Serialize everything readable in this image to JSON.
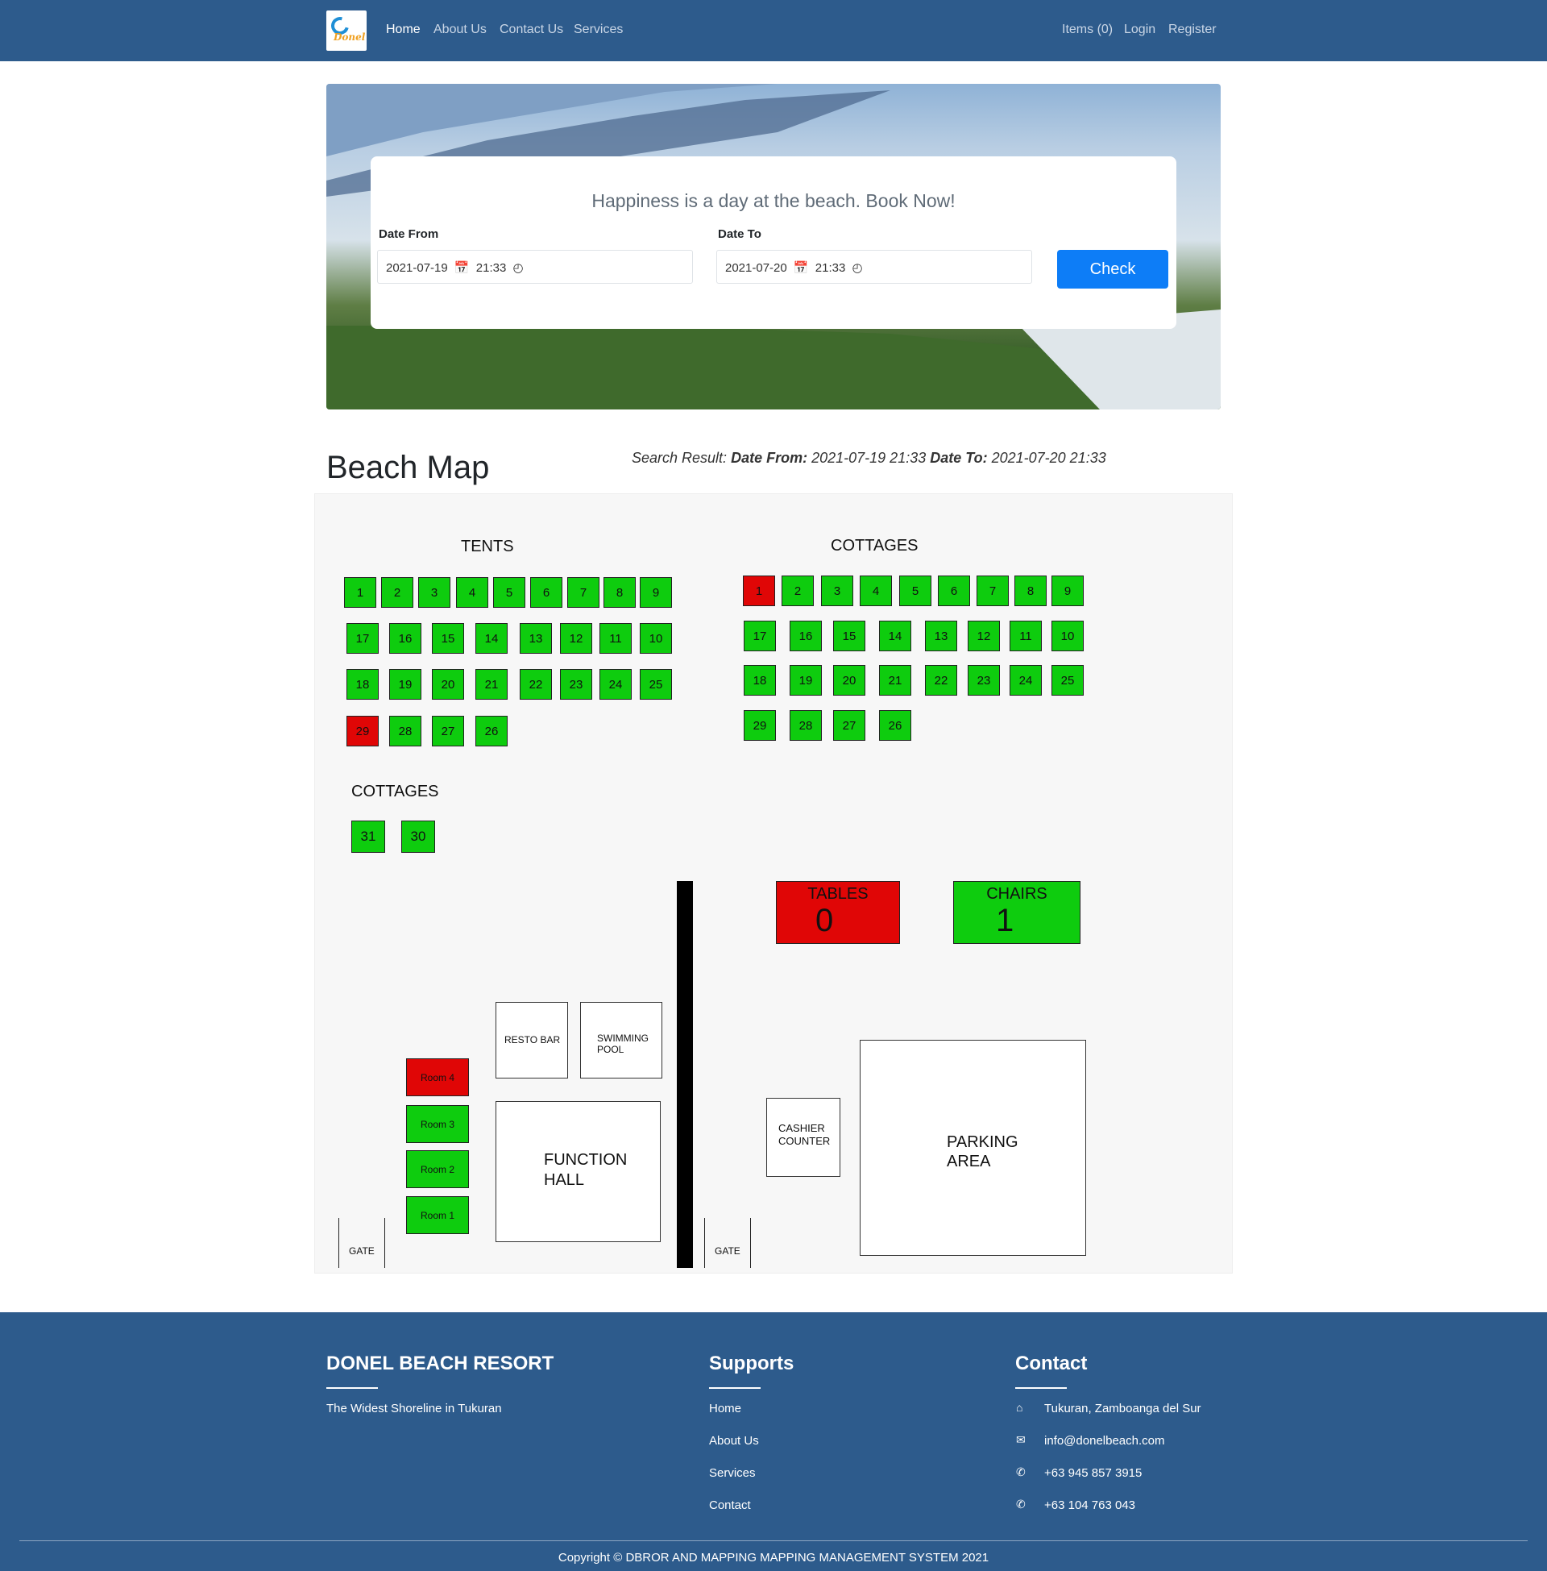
{
  "nav": {
    "logo_text": "Donel",
    "links": [
      "Home",
      "About Us",
      "Contact Us",
      "Services"
    ],
    "items": "Items (0)",
    "login": "Login",
    "register": "Register"
  },
  "booking": {
    "title": "Happiness is a day at the beach. Book Now!",
    "date_from_label": "Date From",
    "date_to_label": "Date To",
    "date_from_date": "2021-07-19",
    "date_from_time": "21:33",
    "date_to_date": "2021-07-20",
    "date_to_time": "21:33",
    "check_label": "Check"
  },
  "map": {
    "title": "Beach Map",
    "search_prefix": "Search Result:",
    "search_from_label": "Date From:",
    "search_from_value": "2021-07-19 21:33",
    "search_to_label": "Date To:",
    "search_to_value": "2021-07-20 21:33",
    "tents_label": "TENTS",
    "cottages_label": "COTTAGES",
    "cottages2_label": "COTTAGES",
    "tents_rows": [
      [
        "1",
        "2",
        "3",
        "4",
        "5",
        "6",
        "7",
        "8",
        "9"
      ],
      [
        "17",
        "16",
        "15",
        "14",
        "13",
        "12",
        "11",
        "10"
      ],
      [
        "18",
        "19",
        "20",
        "21",
        "22",
        "23",
        "24",
        "25"
      ],
      [
        "29",
        "28",
        "27",
        "26"
      ]
    ],
    "cottage_rows": [
      [
        "1",
        "2",
        "3",
        "4",
        "5",
        "6",
        "7",
        "8",
        "9"
      ],
      [
        "17",
        "16",
        "15",
        "14",
        "13",
        "12",
        "11",
        "10"
      ],
      [
        "18",
        "19",
        "20",
        "21",
        "22",
        "23",
        "24",
        "25"
      ],
      [
        "29",
        "28",
        "27",
        "26"
      ]
    ],
    "cottages2": [
      "31",
      "30"
    ],
    "reserved_color": "#e00606",
    "available_color": "#0ecc0e",
    "reserved_tents": [
      "29"
    ],
    "reserved_cottages": [
      "1"
    ],
    "tables_label": "TABLES",
    "tables_value": "0",
    "chairs_label": "CHAIRS",
    "chairs_value": "1",
    "resto_bar": "RESTO BAR",
    "pool_line1": "SWIMMING",
    "pool_line2": "POOL",
    "function_line1": "FUNCTION",
    "function_line2": "HALL",
    "cashier_line1": "CASHIER",
    "cashier_line2": "COUNTER",
    "parking_line1": "PARKING",
    "parking_line2": "AREA",
    "rooms": [
      "Room 4",
      "Room 3",
      "Room 2",
      "Room 1"
    ],
    "reserved_rooms": [
      "Room 4"
    ],
    "gate_label": "GATE"
  },
  "footer": {
    "brand": "DONEL BEACH RESORT",
    "tagline": "The Widest Shoreline in Tukuran",
    "supports_title": "Supports",
    "supports_links": [
      "Home",
      "About Us",
      "Services",
      "Contact"
    ],
    "contact_title": "Contact",
    "address": "Tukuran, Zamboanga del Sur",
    "email": "info@donelbeach.com",
    "phone1": "+63 945 857 3915",
    "phone2": "+63 104 763 043",
    "copyright": "Copyright © DBROR AND MAPPING MAPPING MANAGEMENT SYSTEM 2021"
  }
}
